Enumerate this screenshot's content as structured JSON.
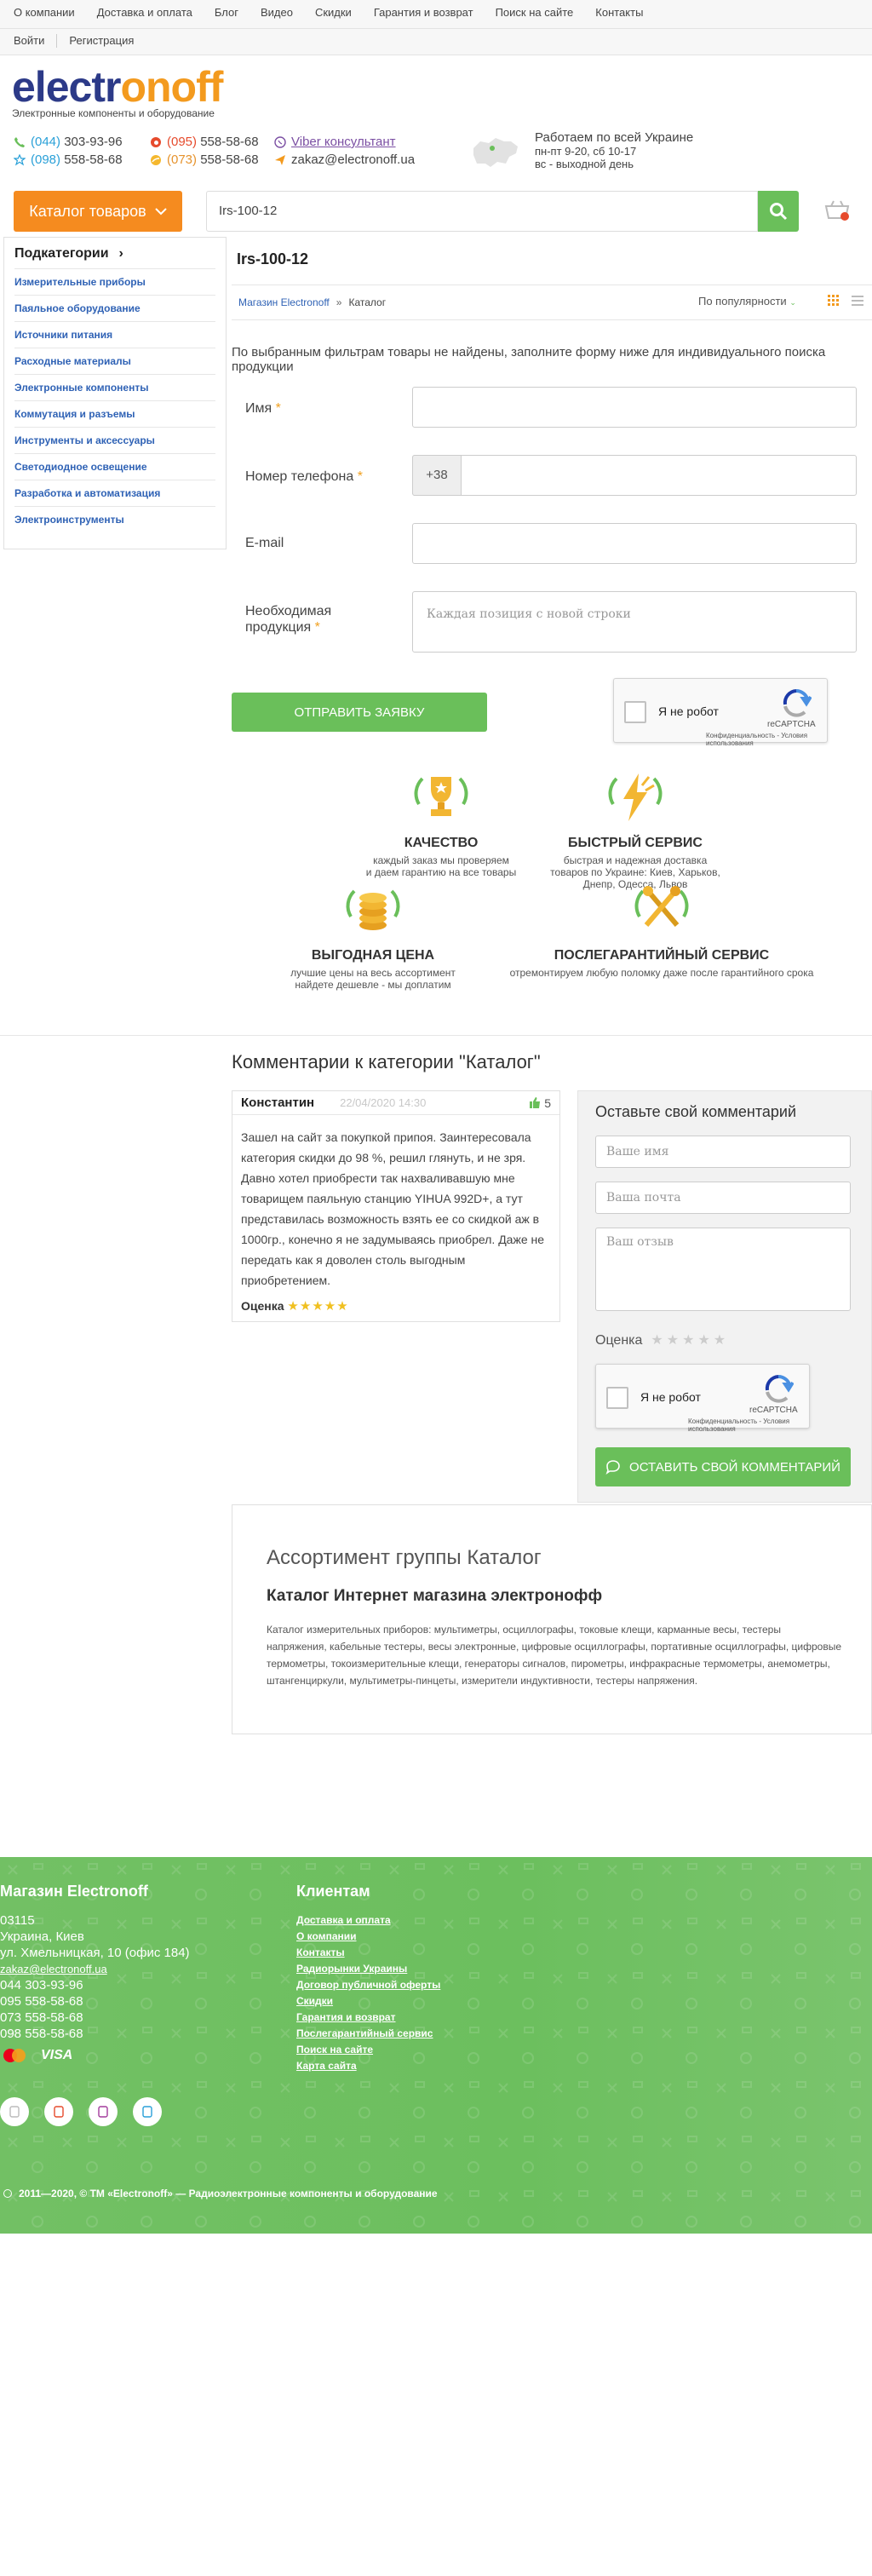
{
  "topnav": [
    "О компании",
    "Доставка и оплата",
    "Блог",
    "Видео",
    "Скидки",
    "Гарантия и возврат",
    "Поиск на сайте",
    "Контакты"
  ],
  "auth": {
    "login": "Войти",
    "register": "Регистрация"
  },
  "logo": {
    "part1": "electr",
    "part2": "o",
    "part3": "noff",
    "tagline": "Электронные компоненты и оборудование"
  },
  "contacts": {
    "p1_code": "(044)",
    "p1_num": "303-93-96",
    "p2_code": "(098)",
    "p2_num": "558-58-68",
    "p3_code": "(095)",
    "p3_num": "558-58-68",
    "p4_code": "(073)",
    "p4_num": "558-58-68",
    "viber": "Viber консультант",
    "email": "zakaz@electronoff.ua"
  },
  "work": {
    "l1": "Работаем по всей Украине",
    "l2": "пн-пт 9-20, сб 10-17",
    "l3": "вс - выходной день"
  },
  "catalog_btn": "Каталог товаров",
  "search_value": "Irs-100-12",
  "sidebar": {
    "title": "Подкатегории",
    "items": [
      "Измерительные приборы",
      "Паяльное оборудование",
      "Источники питания",
      "Расходные материалы",
      "Электронные компоненты",
      "Коммутация и разъемы",
      "Инструменты и аксессуары",
      "Светодиодное освещение",
      "Разработка и автоматизация",
      "Электроинструменты"
    ]
  },
  "page_title": "Irs-100-12",
  "breadcrumb": {
    "home": "Магазин Electronoff",
    "sep": "»",
    "current": "Каталог"
  },
  "sort_label": "По популярности",
  "notice": "По выбранным фильтрам товары не найдены, заполните форму ниже для индивидуального поиска продукции",
  "form": {
    "name_label": "Имя",
    "phone_label": "Номер телефона",
    "phone_prefix": "+38",
    "email_label": "E-mail",
    "product_label_1": "Необходимая",
    "product_label_2": "продукция",
    "product_placeholder": "Каждая позиция с новой строки",
    "submit": "ОТПРАВИТЬ ЗАЯВКУ"
  },
  "captcha": {
    "label": "Я не робот",
    "brand": "reCAPTCHA",
    "privacy": "Конфиденциальность - Условия использования"
  },
  "features": [
    {
      "title": "КАЧЕСТВО",
      "desc1": "каждый заказ мы проверяем",
      "desc2": "и даем гарантию на все товары",
      "desc3": "",
      "icon": "trophy-icon"
    },
    {
      "title": "БЫСТРЫЙ СЕРВИС",
      "desc1": "быстрая и надежная доставка",
      "desc2": "товаров по Украине: Киев, Харьков,",
      "desc3": "Днепр, Одесса, Львов",
      "icon": "lightning-icon"
    },
    {
      "title": "ВЫГОДНАЯ ЦЕНА",
      "desc1": "лучшие цены на весь ассортимент",
      "desc2": "найдете дешевле - мы доплатим",
      "desc3": "",
      "icon": "coins-icon"
    },
    {
      "title": "ПОСЛЕГАРАНТИЙНЫЙ СЕРВИС",
      "desc1": "отремонтируем любую поломку даже после гарантийного срока",
      "desc2": "",
      "desc3": "",
      "icon": "tools-icon"
    }
  ],
  "comments_title": "Комментарии к категории \"Каталог\"",
  "comment": {
    "author": "Константин",
    "date": "22/04/2020 14:30",
    "likes": "5",
    "text": "Зашел на сайт за покупкой припоя. Заинтересовала категория скидки до 98 %, решил глянуть, и не зря. Давно хотел приобрести так нахваливавшую мне товарищем паяльную станцию YIHUA 992D+, а тут представилась возможность взять ее со скидкой аж в 1000гр., конечно я не задумываясь приобрел. Даже не передать как я доволен столь выгодным приобретением.",
    "rating_label": "Оценка",
    "rating": 5
  },
  "leave": {
    "title": "Оставьте свой комментарий",
    "name_ph": "Ваше имя",
    "email_ph": "Ваша почта",
    "review_ph": "Ваш отзыв",
    "score_label": "Оценка",
    "submit": "ОСТАВИТЬ СВОЙ КОММЕНТАРИЙ"
  },
  "assort": {
    "h2": "Ассортимент группы Каталог",
    "h3": "Каталог Интернет магазина электронофф",
    "text": "Каталог измерительных приборов: мультиметры, осциллографы, токовые клещи, карманные весы, тестеры напряжения, кабельные тестеры, весы электронные, цифровые осциллографы, портативные осциллографы, цифровые термометры, токоизмерительные клещи, генераторы сигналов, пирометры, инфракрасные термометры, анемометры, штангенциркули, мультиметры-пинцеты, измерители индуктивности, тестеры напряжения."
  },
  "footer": {
    "shop_title": "Магазин Electronoff",
    "zip": "03115",
    "country": "Украина, Киев",
    "street": "ул. Хмельницкая, 10 (офис 184)",
    "email": "zakaz@electronoff.ua",
    "phones": [
      "044 303-93-96",
      "095 558-58-68",
      "073 558-58-68",
      "098 558-58-68"
    ],
    "clients_title": "Клиентам",
    "links": [
      "Доставка и оплата",
      "О компании",
      "Контакты",
      "Радиорынки Украины",
      "Договор публичной оферты",
      "Скидки",
      "Гарантия и возврат",
      "Послегарантийный сервис",
      "Поиск на сайте",
      "Карта сайта"
    ],
    "visa": "VISA",
    "copyright": "2011—2020, © ТМ «Electronoff» — Радиоэлектронные компоненты и оборудование"
  },
  "colors": {
    "brand_blue": "#2c3a88",
    "brand_orange": "#f39a1e",
    "accent_green": "#6abf5a",
    "catalog_orange": "#f58b1f",
    "link_blue": "#2f62b5"
  }
}
